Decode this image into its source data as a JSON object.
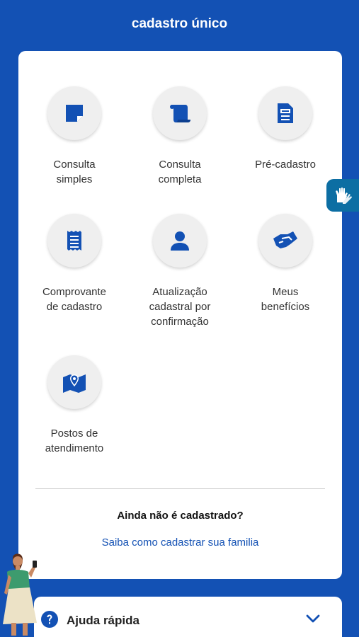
{
  "header": {
    "title": "cadastro único"
  },
  "services": [
    {
      "label": "Consulta\nsimples",
      "icon": "note-icon"
    },
    {
      "label": "Consulta\ncompleta",
      "icon": "scroll-icon"
    },
    {
      "label": "Pré-cadastro",
      "icon": "form-document-icon"
    },
    {
      "label": "Comprovante\nde cadastro",
      "icon": "receipt-icon"
    },
    {
      "label": "Atualização\ncadastral por\nconfirmação",
      "icon": "person-icon"
    },
    {
      "label": "Meus\nbenefícios",
      "icon": "handshake-icon"
    },
    {
      "label": "Postos de\natendimento",
      "icon": "map-pin-icon"
    }
  ],
  "signup": {
    "question": "Ainda não é cadastrado?",
    "link": "Saiba como cadastrar sua familia"
  },
  "quick_help": {
    "label": "Ajuda rápida",
    "icon": "question-circle-icon"
  },
  "accessibility": {
    "icon": "sign-language-hands-icon"
  },
  "colors": {
    "primary": "#1351b4",
    "icon": "#1351b4",
    "vlibras": "#0c6ea3"
  }
}
